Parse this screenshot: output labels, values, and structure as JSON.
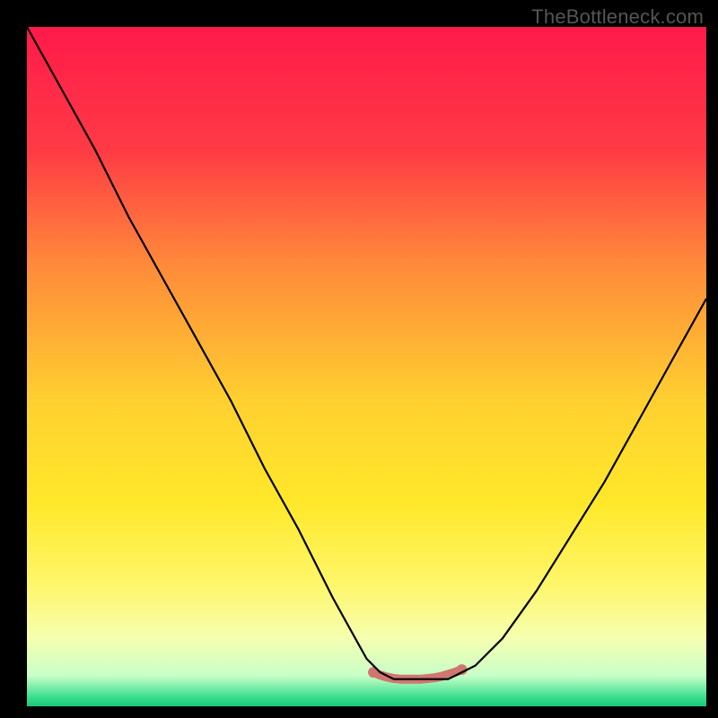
{
  "watermark": "TheBottleneck.com",
  "chart_data": {
    "type": "line",
    "title": "",
    "xlabel": "",
    "ylabel": "",
    "xlim": [
      0,
      100
    ],
    "ylim": [
      0,
      100
    ],
    "background_gradient": {
      "stops": [
        {
          "pos": 0.0,
          "color": "#ff1a4a"
        },
        {
          "pos": 0.18,
          "color": "#ff3a45"
        },
        {
          "pos": 0.35,
          "color": "#ff8a3a"
        },
        {
          "pos": 0.55,
          "color": "#ffd030"
        },
        {
          "pos": 0.7,
          "color": "#ffe82a"
        },
        {
          "pos": 0.82,
          "color": "#fff66a"
        },
        {
          "pos": 0.9,
          "color": "#f5ffb0"
        },
        {
          "pos": 0.955,
          "color": "#c8ffc8"
        },
        {
          "pos": 0.985,
          "color": "#40e090"
        },
        {
          "pos": 1.0,
          "color": "#18c878"
        }
      ]
    },
    "series": [
      {
        "name": "bottleneck-curve",
        "color": "#000000",
        "x": [
          0,
          5,
          10,
          15,
          20,
          25,
          30,
          35,
          40,
          45,
          50,
          52,
          54,
          56,
          58,
          60,
          62,
          64,
          66,
          70,
          75,
          80,
          85,
          90,
          95,
          100
        ],
        "y": [
          100,
          91,
          82,
          72,
          63,
          54,
          45,
          35,
          26,
          16,
          7,
          5,
          4,
          4,
          4,
          4,
          4,
          5,
          6,
          10,
          17,
          25,
          33,
          42,
          51,
          60
        ]
      },
      {
        "name": "flat-segment-marker",
        "color": "#d0766e",
        "x": [
          51,
          52,
          53,
          54,
          55,
          56,
          57,
          58,
          59,
          60,
          61,
          62,
          63,
          64
        ],
        "y": [
          5,
          4.6,
          4.3,
          4.1,
          4.0,
          4.0,
          4.0,
          4.0,
          4.1,
          4.2,
          4.4,
          4.7,
          5.0,
          5.4
        ]
      }
    ]
  }
}
